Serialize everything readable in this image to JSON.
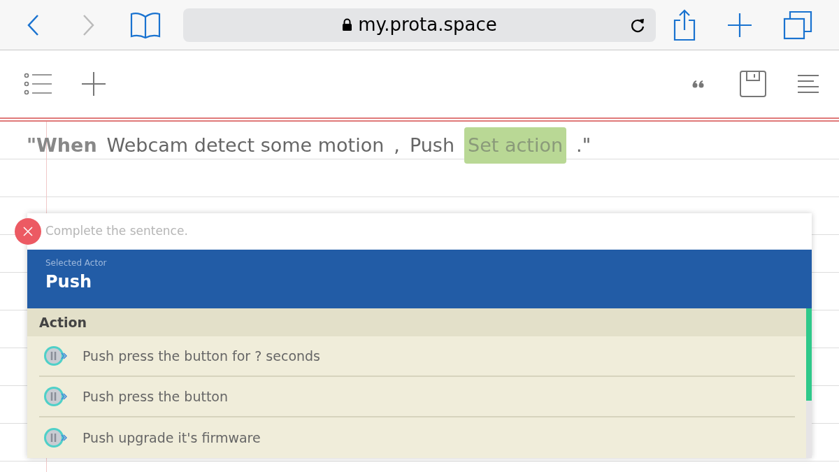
{
  "browser": {
    "url": "my.prota.space"
  },
  "sentence": [
    {
      "kind": "keyword",
      "text": "\"When"
    },
    {
      "kind": "plain",
      "text": "Webcam detect some motion"
    },
    {
      "kind": "plain",
      "text": ","
    },
    {
      "kind": "plain",
      "text": "Push"
    },
    {
      "kind": "slot",
      "text": "Set action"
    },
    {
      "kind": "plain",
      "text": ".\""
    }
  ],
  "dialog": {
    "prompt": "Complete the sentence.",
    "actor_label": "Selected Actor",
    "actor": "Push",
    "section": "Action",
    "items": [
      {
        "label": "Push press the button for ? seconds"
      },
      {
        "label": "Push press the button"
      },
      {
        "label": "Push upgrade it's firmware"
      }
    ]
  }
}
